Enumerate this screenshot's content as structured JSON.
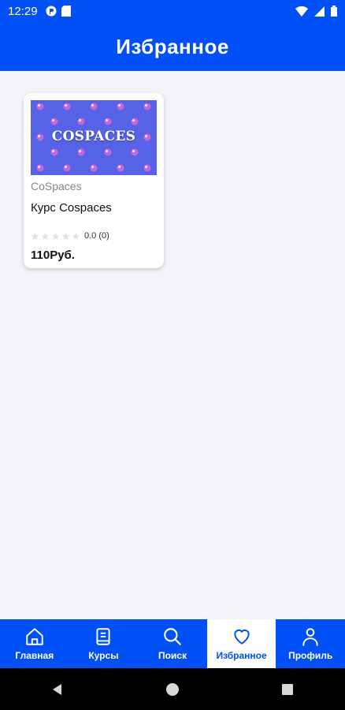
{
  "status_bar": {
    "time": "12:29",
    "icons": [
      "app-icon",
      "sd-card-icon",
      "wifi-icon",
      "signal-icon",
      "battery-icon"
    ]
  },
  "header": {
    "title": "Избранное"
  },
  "favorites": [
    {
      "thumbnail_text": "COSPACES",
      "category": "CoSpaces",
      "title": "Курс Cospaces",
      "rating": 0.0,
      "rating_text": "0.0 (0)",
      "price": "110Руб."
    }
  ],
  "bottom_nav": {
    "items": [
      {
        "label": "Главная",
        "icon": "home-icon",
        "active": false
      },
      {
        "label": "Курсы",
        "icon": "book-icon",
        "active": false
      },
      {
        "label": "Поиск",
        "icon": "search-icon",
        "active": false
      },
      {
        "label": "Избранное",
        "icon": "heart-icon",
        "active": true
      },
      {
        "label": "Профиль",
        "icon": "user-icon",
        "active": false
      }
    ]
  },
  "colors": {
    "primary": "#0050f5",
    "background": "#f2f4f8",
    "thumbnail_bg": "#5763e6"
  }
}
